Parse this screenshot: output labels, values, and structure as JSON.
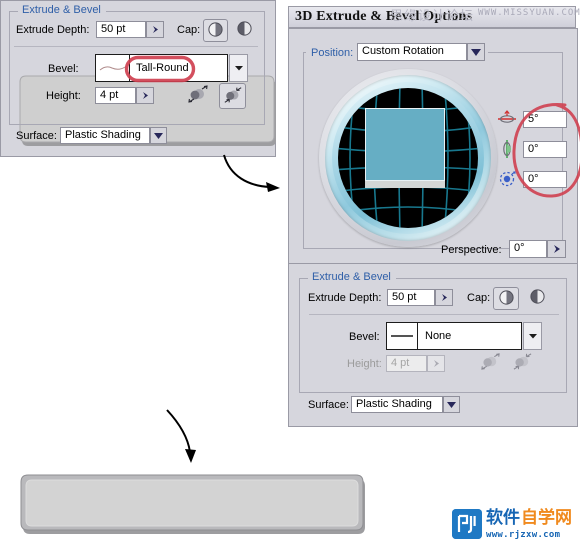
{
  "dialog": {
    "title": "3D Extrude & Bevel Options",
    "position": {
      "label": "Position:",
      "value": "Custom Rotation"
    },
    "rotation": {
      "x_value": "5°",
      "y_value": "0°",
      "z_value": "0°",
      "x_icon": "rotate-x-axis-icon",
      "y_icon": "rotate-y-axis-icon",
      "z_icon": "rotate-z-axis-icon"
    },
    "perspective": {
      "label": "Perspective:",
      "value": "0°"
    }
  },
  "panel_left": {
    "legend": "Extrude & Bevel",
    "extrude_depth_label": "Extrude Depth:",
    "extrude_depth_value": "50 pt",
    "cap_label": "Cap:",
    "bevel_label": "Bevel:",
    "bevel_value": "Tall-Round",
    "height_label": "Height:",
    "height_value": "4 pt",
    "surface_label": "Surface:",
    "surface_value": "Plastic Shading"
  },
  "panel_right": {
    "legend": "Extrude & Bevel",
    "extrude_depth_label": "Extrude Depth:",
    "extrude_depth_value": "50 pt",
    "cap_label": "Cap:",
    "bevel_label": "Bevel:",
    "bevel_value": "None",
    "height_label": "Height:",
    "height_value": "4 pt",
    "surface_label": "Surface:",
    "surface_value": "Plastic Shading"
  },
  "watermark": {
    "chinese": "思缘设计论坛",
    "url": "WWW.MISSYUAN.COM"
  },
  "logo": {
    "text_a": "软件",
    "text_b": "自学网",
    "url": "www.rjzxw.com",
    "color_a": "#1766b4",
    "color_b": "#f08a1e"
  },
  "colors": {
    "dialog_bg": "#d6d6dd",
    "legend_blue": "#2f5fa8",
    "annotation_red": "#cf4050",
    "art_fill": "#cfcfcf",
    "globe_wire": "#1a7f96"
  }
}
